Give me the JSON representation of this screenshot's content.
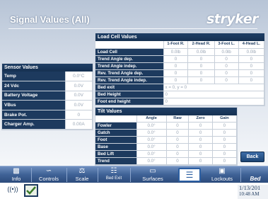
{
  "header": {
    "title": "Signal Values (All)",
    "brand": "stryker"
  },
  "sensor": {
    "title": "Sensor Values",
    "rows": [
      {
        "label": "Temp",
        "value": "0.0°C"
      },
      {
        "label": "24 Vdc",
        "value": "0.0V"
      },
      {
        "label": "Battery Voltage",
        "value": "0.0V"
      },
      {
        "label": "VBus",
        "value": "0.0V"
      },
      {
        "label": "Brake Pot.",
        "value": "0"
      },
      {
        "label": "Charger Amp.",
        "value": "0.00A"
      }
    ]
  },
  "loadcell": {
    "title": "Load Cell Values",
    "columns": [
      "1-Foot R.",
      "2-Head R.",
      "3-Foot L.",
      "4-Head L."
    ],
    "rows": [
      {
        "label": "Load Cell",
        "values": [
          "0.0lb",
          "0.0lb",
          "0.0lb",
          "0.0lb"
        ]
      },
      {
        "label": "Trend Angle dep.",
        "values": [
          "0",
          "0",
          "0",
          "0"
        ]
      },
      {
        "label": "Trend Angle indep.",
        "values": [
          "0",
          "0",
          "0",
          "0"
        ]
      },
      {
        "label": "Rev. Trend Angle dep.",
        "values": [
          "0",
          "0",
          "0",
          "0"
        ]
      },
      {
        "label": "Rev. Trend Angle indep.",
        "values": [
          "0",
          "0",
          "0",
          "0"
        ]
      }
    ],
    "extra": [
      {
        "label": "Bed exit",
        "value": "x = 0, y = 0"
      },
      {
        "label": "Bed Height",
        "value": "0"
      },
      {
        "label": "Foot end height",
        "value": "0"
      }
    ]
  },
  "tilt": {
    "title": "Tilt Values",
    "columns": [
      "Angle",
      "Raw",
      "Zero",
      "Gain"
    ],
    "rows": [
      {
        "label": "Fowler",
        "values": [
          "0.0°",
          "0",
          "0",
          "0"
        ]
      },
      {
        "label": "Gatch",
        "values": [
          "0.0°",
          "0",
          "0",
          "0"
        ]
      },
      {
        "label": "Foot",
        "values": [
          "0.0°",
          "0",
          "0",
          "0"
        ]
      },
      {
        "label": "Base",
        "values": [
          "0.0°",
          "0",
          "0",
          "0"
        ]
      },
      {
        "label": "Bed Lift",
        "values": [
          "0.0°",
          "0",
          "0",
          "0"
        ]
      },
      {
        "label": "Trend",
        "values": [
          "0.0°",
          "0",
          "0",
          "0"
        ]
      }
    ]
  },
  "back_label": "Back",
  "nav": {
    "items": [
      {
        "label": "Info",
        "icon": "info-icon"
      },
      {
        "label": "Controls",
        "icon": "controls-icon"
      },
      {
        "label": "Scale",
        "icon": "scale-icon"
      },
      {
        "label": "Bed Exit",
        "icon": "bed-exit-icon"
      },
      {
        "label": "Surfaces",
        "icon": "surfaces-icon"
      },
      {
        "label": "",
        "icon": "service-sliders-icon"
      },
      {
        "label": "Lockouts",
        "icon": "lock-icon"
      },
      {
        "label": "Bed",
        "icon": "bed-icon"
      }
    ]
  },
  "status": {
    "date": "1/13/201",
    "time": "10:48 AM"
  }
}
